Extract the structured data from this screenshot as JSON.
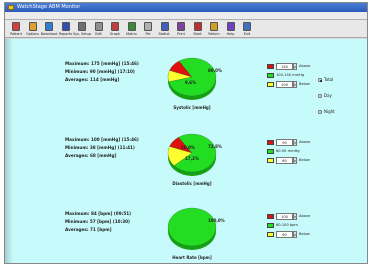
{
  "window": {
    "title": "WatchStage ABM Monitor"
  },
  "menu": [
    "File",
    "Download",
    "Options",
    "Reports",
    "Edit",
    "Help",
    "Language"
  ],
  "toolbar": [
    {
      "label": "Patient",
      "icon": "patient-icon",
      "color": "#d04040"
    },
    {
      "label": "Options",
      "icon": "options-icon",
      "color": "#e0a030"
    },
    {
      "label": "Download",
      "icon": "download-icon",
      "color": "#2f7fd0"
    },
    {
      "label": "Reports",
      "icon": "reports-icon",
      "color": "#3050b0"
    },
    {
      "label": "Sys. Setup",
      "icon": "setup-icon",
      "color": "#707070"
    },
    {
      "label": "Edit",
      "icon": "edit-icon",
      "color": "#909090"
    },
    {
      "label": "Graph",
      "icon": "graph-icon",
      "color": "#c04040"
    },
    {
      "label": "Matrix",
      "icon": "matrix-icon",
      "color": "#3a8a3a"
    },
    {
      "label": "Pie",
      "icon": "pie-icon",
      "color": "#b0b0b0"
    },
    {
      "label": "Statist.",
      "icon": "statistics-icon",
      "color": "#4060c0"
    },
    {
      "label": "Print",
      "icon": "print-icon",
      "color": "#8040a0"
    },
    {
      "label": "Start",
      "icon": "start-icon",
      "color": "#c03030"
    },
    {
      "label": "Return",
      "icon": "return-icon",
      "color": "#d0a020"
    },
    {
      "label": "Help",
      "icon": "help-icon",
      "color": "#7040c0"
    },
    {
      "label": "Exit",
      "icon": "exit-icon",
      "color": "#4070c0"
    }
  ],
  "periods": [
    {
      "label": "Total",
      "selected": true
    },
    {
      "label": "Day",
      "selected": false
    },
    {
      "label": "Night",
      "selected": false
    }
  ],
  "colors": {
    "above": "#e01010",
    "normal": "#22dd22",
    "below": "#ffff30"
  },
  "panels": [
    {
      "maximum": "Maximum: 175 [mmHg] (15:46)",
      "minimum": "Minimum: 90 [mmHg] (17:10)",
      "average": "Averages: 114 [mmHg]",
      "pie_title": "Systolic [mmHg]",
      "slices": {
        "above": 10.4,
        "normal": 80.0,
        "below": 9.6
      },
      "label_normal": "80,0%",
      "label_above": "",
      "label_below": "9,6%",
      "legend": {
        "above_value": "140",
        "above_text": "Above",
        "normal_text": "100-140 mmHg",
        "below_value": "100",
        "below_text": "Below"
      }
    },
    {
      "maximum": "Maximum: 100 [mmHg] (15:46)",
      "minimum": "Minimum: 38 [mmHg] (11:41)",
      "average": "Averages: 68 [mmHg]",
      "pie_title": "Diastolic [mmHg]",
      "slices": {
        "above": 10.0,
        "normal": 72.8,
        "below": 17.2
      },
      "label_normal": "72,8%",
      "label_above": "10,0%",
      "label_below": "17,2%",
      "legend": {
        "above_value": "90",
        "above_text": "Above",
        "normal_text": "60-90 mmHg",
        "below_value": "60",
        "below_text": "Below"
      }
    },
    {
      "maximum": "Maximum: 84 [bpm] (09:51)",
      "minimum": "Minimum: 57 [bpm] (10:30)",
      "average": "Averages: 71 [bpm]",
      "pie_title": "Heart Rate [bpm]",
      "slices": {
        "above": 0,
        "normal": 100.0,
        "below": 0
      },
      "label_normal": "100,0%",
      "label_above": "",
      "label_below": "",
      "legend": {
        "above_value": "100",
        "above_text": "Above",
        "normal_text": "60-100 bpm",
        "below_value": "60",
        "below_text": "Below"
      }
    }
  ]
}
